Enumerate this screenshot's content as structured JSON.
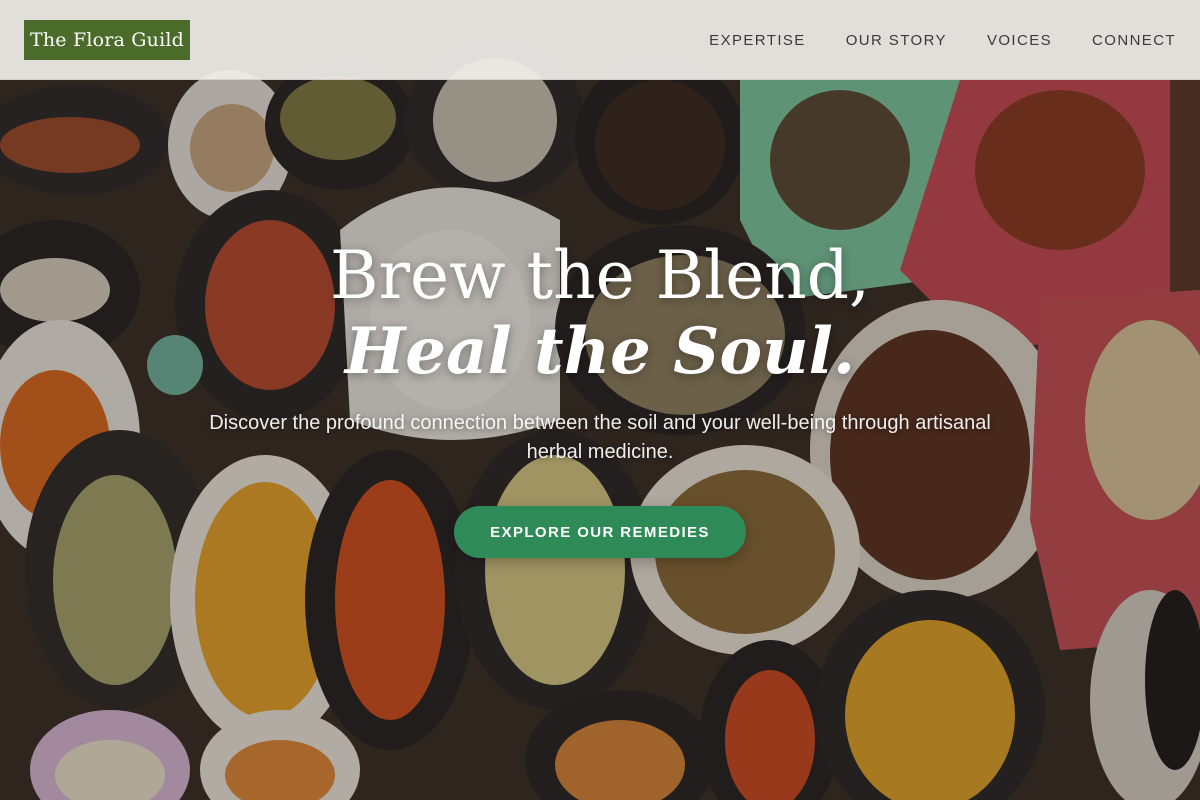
{
  "header": {
    "logo": "The Flora Guild",
    "nav": [
      "EXPERTISE",
      "OUR STORY",
      "VOICES",
      "CONNECT"
    ]
  },
  "hero": {
    "title_line1": "Brew the Blend,",
    "title_line2": "Heal the Soul.",
    "subtitle": "Discover the profound connection between the soil and your well-being through artisanal herbal medicine.",
    "cta_label": "EXPLORE OUR REMEDIES",
    "background": "spice-market-sacks-photo"
  },
  "colors": {
    "logo_bg": "#4a6b2a",
    "cta_bg": "#2e8b57",
    "header_bg": "#f0eeea",
    "nav_text": "#3a3a3a"
  }
}
